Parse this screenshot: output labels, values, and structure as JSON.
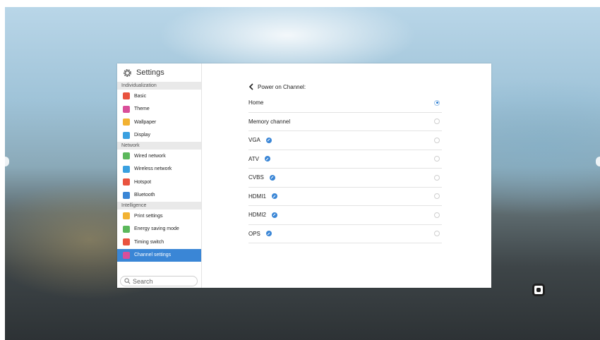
{
  "settings": {
    "title": "Settings",
    "icon": "gear-icon",
    "sections": [
      {
        "label": "Individualization",
        "items": [
          {
            "label": "Basic",
            "icon": "basic-icon",
            "color": "#e9533f"
          },
          {
            "label": "Theme",
            "icon": "theme-icon",
            "color": "#d94f9a"
          },
          {
            "label": "Wallpaper",
            "icon": "wallpaper-icon",
            "color": "#f2b232"
          },
          {
            "label": "Display",
            "icon": "display-icon",
            "color": "#3aa0e0"
          }
        ]
      },
      {
        "label": "Network",
        "items": [
          {
            "label": "Wired network",
            "icon": "wired-network-icon",
            "color": "#5cb85c"
          },
          {
            "label": "Wireless network",
            "icon": "wifi-icon",
            "color": "#3aa0e0"
          },
          {
            "label": "Hotspot",
            "icon": "hotspot-icon",
            "color": "#e9533f"
          },
          {
            "label": "Bluetooth",
            "icon": "bluetooth-icon",
            "color": "#3a86d6"
          }
        ]
      },
      {
        "label": "Intelligence",
        "items": [
          {
            "label": "Print settings",
            "icon": "print-icon",
            "color": "#f2b232"
          },
          {
            "label": "Energy saving mode",
            "icon": "energy-icon",
            "color": "#5cb85c"
          },
          {
            "label": "Timing switch",
            "icon": "timer-icon",
            "color": "#e9533f"
          },
          {
            "label": "Channel settings",
            "icon": "channel-icon",
            "color": "#d94f9a",
            "active": true
          }
        ]
      }
    ],
    "search_placeholder": "Search"
  },
  "main": {
    "back_title": "Power on Channel:",
    "channels": [
      {
        "label": "Home",
        "selected": true,
        "has_tag": false
      },
      {
        "label": "Memory channel",
        "selected": false,
        "has_tag": false
      },
      {
        "label": "VGA",
        "selected": false,
        "has_tag": true
      },
      {
        "label": "ATV",
        "selected": false,
        "has_tag": true
      },
      {
        "label": "CVBS",
        "selected": false,
        "has_tag": true
      },
      {
        "label": "HDMI1",
        "selected": false,
        "has_tag": true
      },
      {
        "label": "HDMI2",
        "selected": false,
        "has_tag": true
      },
      {
        "label": "OPS",
        "selected": false,
        "has_tag": true
      }
    ]
  },
  "colors": {
    "accent": "#3a86d6",
    "radio_selected": "#2f7fd2"
  }
}
